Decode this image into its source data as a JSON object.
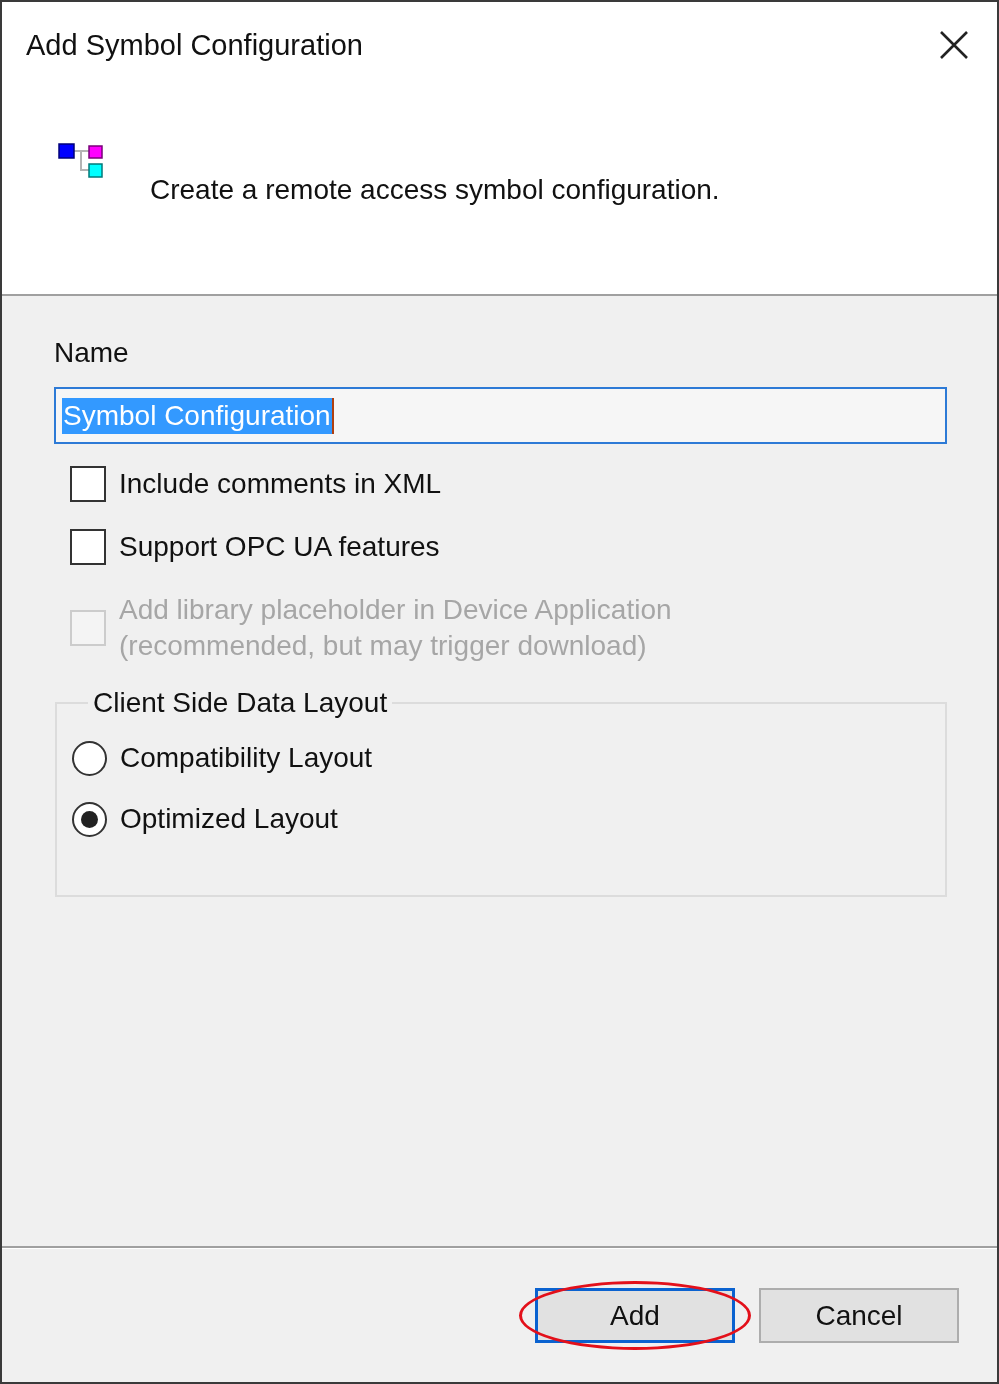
{
  "window": {
    "title": "Add Symbol Configuration"
  },
  "header": {
    "description": "Create a remote access symbol configuration."
  },
  "name_field": {
    "label": "Name",
    "value": "Symbol Configuration",
    "focused": true,
    "text_selected": true
  },
  "options": [
    {
      "label": "Include comments in XML",
      "checked": false,
      "disabled": false
    },
    {
      "label": "Support OPC UA features",
      "checked": false,
      "disabled": false
    },
    {
      "label": "Add library placeholder in Device Application (recommended, but may trigger download)",
      "checked": false,
      "disabled": true
    }
  ],
  "layout_group": {
    "title": "Client Side Data Layout",
    "options": [
      {
        "label": "Compatibility Layout",
        "selected": false
      },
      {
        "label": "Optimized Layout",
        "selected": true
      }
    ]
  },
  "buttons": [
    {
      "label": "Add",
      "default": true,
      "circled": true
    },
    {
      "label": "Cancel",
      "default": false,
      "circled": false
    }
  ]
}
